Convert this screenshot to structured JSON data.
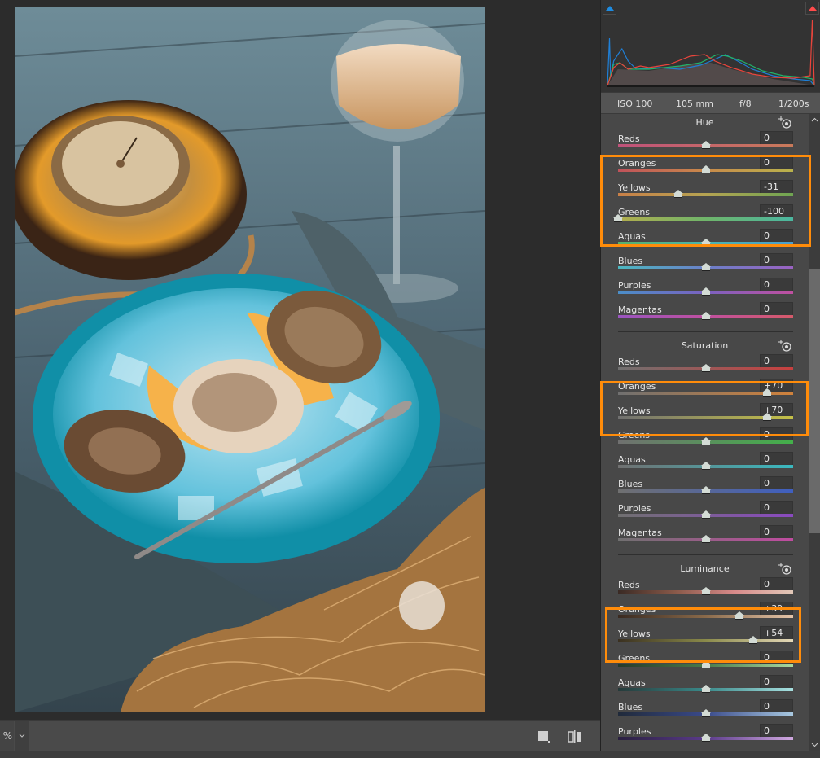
{
  "canvas": {
    "zoom_value": "%",
    "zoom_dropdown_icon": "chevron-down-icon",
    "view_mode_icon": "single-view-icon",
    "before_after_icon": "before-after-split-icon"
  },
  "histogram": {
    "clip_shadows_icon": "shadow-clipping-warning-icon",
    "clip_highlights_icon": "highlight-clipping-warning-icon",
    "colors": {
      "red": "#e8453c",
      "green": "#21b36b",
      "blue": "#1f7fd6"
    }
  },
  "metadata": {
    "iso": "ISO 100",
    "focal_length": "105 mm",
    "aperture": "f/8",
    "shutter": "1/200s"
  },
  "accent_color": "#ff8c0a",
  "sections": [
    {
      "title": "Hue",
      "target_icon": "targeted-adjustment-icon",
      "rows": [
        {
          "label": "Reds",
          "value": "0",
          "numeric": 0
        },
        {
          "label": "Oranges",
          "value": "0",
          "numeric": 0
        },
        {
          "label": "Yellows",
          "value": "-31",
          "numeric": -31
        },
        {
          "label": "Greens",
          "value": "-100",
          "numeric": -100
        },
        {
          "label": "Aquas",
          "value": "0",
          "numeric": 0
        },
        {
          "label": "Blues",
          "value": "0",
          "numeric": 0
        },
        {
          "label": "Purples",
          "value": "0",
          "numeric": 0
        },
        {
          "label": "Magentas",
          "value": "0",
          "numeric": 0
        }
      ]
    },
    {
      "title": "Saturation",
      "target_icon": "targeted-adjustment-icon",
      "rows": [
        {
          "label": "Reds",
          "value": "0",
          "numeric": 0
        },
        {
          "label": "Oranges",
          "value": "+70",
          "numeric": 70
        },
        {
          "label": "Yellows",
          "value": "+70",
          "numeric": 70
        },
        {
          "label": "Greens",
          "value": "0",
          "numeric": 0
        },
        {
          "label": "Aquas",
          "value": "0",
          "numeric": 0
        },
        {
          "label": "Blues",
          "value": "0",
          "numeric": 0
        },
        {
          "label": "Purples",
          "value": "0",
          "numeric": 0
        },
        {
          "label": "Magentas",
          "value": "0",
          "numeric": 0
        }
      ]
    },
    {
      "title": "Luminance",
      "target_icon": "targeted-adjustment-icon",
      "rows": [
        {
          "label": "Reds",
          "value": "0",
          "numeric": 0
        },
        {
          "label": "Oranges",
          "value": "+39",
          "numeric": 39
        },
        {
          "label": "Yellows",
          "value": "+54",
          "numeric": 54
        },
        {
          "label": "Greens",
          "value": "0",
          "numeric": 0
        },
        {
          "label": "Aquas",
          "value": "0",
          "numeric": 0
        },
        {
          "label": "Blues",
          "value": "0",
          "numeric": 0
        },
        {
          "label": "Purples",
          "value": "0",
          "numeric": 0
        }
      ]
    }
  ],
  "scrollbar": {
    "up_icon": "^",
    "down_icon": "v"
  }
}
